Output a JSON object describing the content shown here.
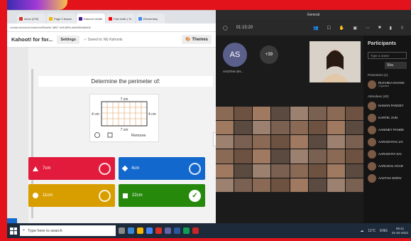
{
  "browser": {
    "tabs": [
      {
        "label": "Inbox (978)",
        "color": "#d93025"
      },
      {
        "label": "Page 2 lesson",
        "color": "#f4b400"
      },
      {
        "label": "Kahoot! create",
        "color": "#46178f"
      },
      {
        "label": "Fast math | Yo",
        "color": "#ff0000"
      },
      {
        "label": "Elementary",
        "color": "#4285f4"
      }
    ],
    "url": "create.kahoot.it/creator/cf06ae5e-3867-4eff-8f0b-a9b096dd6d0b"
  },
  "kahoot": {
    "title": "Kahoot! for for...",
    "settings_label": "Settings",
    "saved_label": "Saved to: My Kahoots",
    "themes_label": "Themes",
    "question": "Determine the perimeter of:",
    "image": {
      "top_dim": "7 cm",
      "bottom_dim": "7 cm",
      "left_dim": "4 cm",
      "right_dim": "4 cm",
      "remove_label": "Remove"
    },
    "answers": [
      {
        "label": "7cm",
        "shape": "triangle",
        "color": "#e21b3c",
        "correct": false
      },
      {
        "label": "4cm",
        "shape": "diamond",
        "color": "#1368ce",
        "correct": false
      },
      {
        "label": "11cm",
        "shape": "circle",
        "color": "#d89e00",
        "correct": false
      },
      {
        "label": "22cm",
        "shape": "square",
        "color": "#26890c",
        "correct": true
      }
    ],
    "next_chevron": "›"
  },
  "teams": {
    "window_title": "General",
    "timer": "01:15:20",
    "participant_count_badge": "+39",
    "avatar_initials": "AS",
    "avatar_name": "AASTHA SH...",
    "panel": {
      "title": "Participants",
      "search_placeholder": "Type a name",
      "share_label": "Sha",
      "presenters_header": "Presenters (1)",
      "presenters": [
        {
          "name": "RUCHIKA KHANC",
          "role": "Organizer"
        }
      ],
      "attendees_header": "Attendees (40)",
      "attendees": [
        {
          "name": "NAMAN PANDEY"
        },
        {
          "name": "KARTIK JAIN"
        },
        {
          "name": "AANINEY PANDE"
        },
        {
          "name": "AARADHYA2 JAI"
        },
        {
          "name": "AARADHYA SAI"
        },
        {
          "name": "AARUSH1 AGAR"
        },
        {
          "name": "AASTHA SHRIV"
        }
      ]
    }
  },
  "taskbar": {
    "search_placeholder": "Type here to search",
    "weather": "11°C",
    "lang": "ENG",
    "time": "09:41",
    "date": "01-02-2022"
  }
}
